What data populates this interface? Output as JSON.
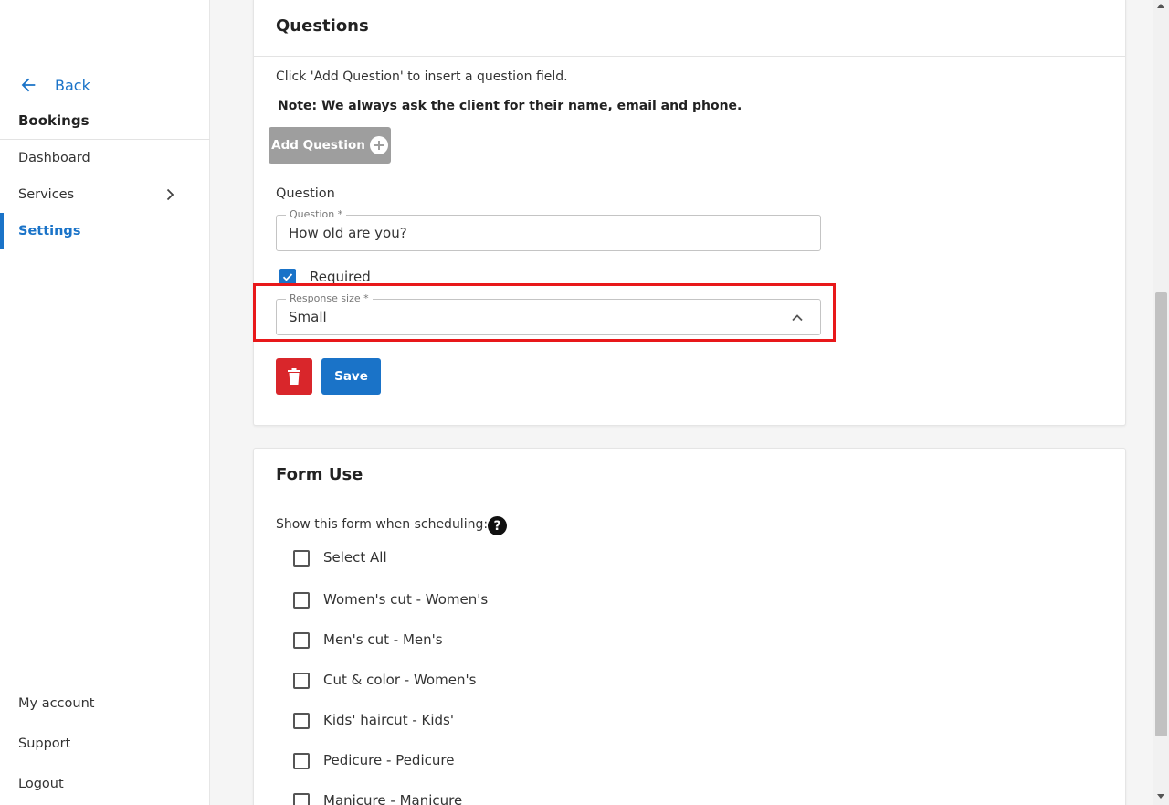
{
  "sidebar": {
    "back_label": "Back",
    "section_title": "Bookings",
    "items": [
      {
        "label": "Dashboard"
      },
      {
        "label": "Services"
      },
      {
        "label": "Settings"
      }
    ],
    "bottom_items": [
      {
        "label": "My account"
      },
      {
        "label": "Support"
      },
      {
        "label": "Logout"
      }
    ]
  },
  "questions_card": {
    "title": "Questions",
    "instruction": "Click 'Add Question' to insert a question field.",
    "note": "Note: We always ask the client for their name, email and phone.",
    "add_button_label": "Add Question",
    "question_heading": "Question",
    "question_field": {
      "label": "Question *",
      "value": "How old are you?"
    },
    "required_label": "Required",
    "required_checked": true,
    "response_size_field": {
      "label": "Response size *",
      "value": "Small"
    },
    "save_label": "Save"
  },
  "form_use_card": {
    "title": "Form Use",
    "prompt": "Show this form when scheduling:",
    "help_icon": "?",
    "options": [
      {
        "label": "Select All",
        "checked": false
      },
      {
        "label": "Women's cut - Women's",
        "checked": false
      },
      {
        "label": "Men's cut - Men's",
        "checked": false
      },
      {
        "label": "Cut & color - Women's",
        "checked": false
      },
      {
        "label": "Kids' haircut - Kids'",
        "checked": false
      },
      {
        "label": "Pedicure - Pedicure",
        "checked": false
      },
      {
        "label": "Manicure - Manicure",
        "checked": false
      }
    ]
  },
  "colors": {
    "accent": "#1a73c8",
    "danger": "#d9262b",
    "highlight": "#e8181a",
    "disabled_button": "#9e9e9e"
  }
}
